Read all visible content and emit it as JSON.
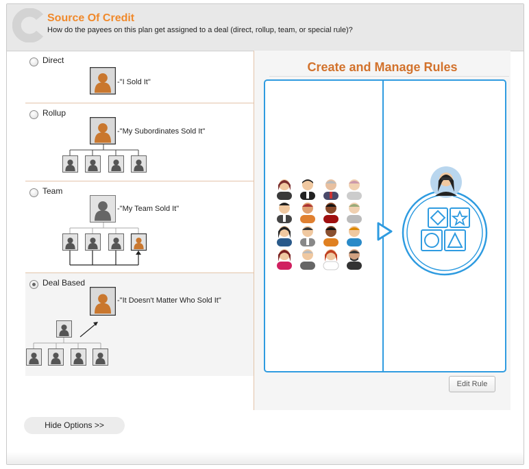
{
  "header": {
    "title": "Source Of Credit",
    "subtitle": "How do the payees on this plan get assigned to a deal (direct, rollup, team, or special rule)?"
  },
  "options": [
    {
      "label": "Direct",
      "quote": "-\"I Sold It\"",
      "selected": false
    },
    {
      "label": "Rollup",
      "quote": "-\"My Subordinates Sold It\"",
      "selected": false
    },
    {
      "label": "Team",
      "quote": "-\"My Team Sold It\"",
      "selected": false
    },
    {
      "label": "Deal Based",
      "quote": "-\"It Doesn't Matter Who Sold It\"",
      "selected": true
    }
  ],
  "rules_panel": {
    "title": "Create and Manage Rules",
    "edit_button": "Edit Rule"
  },
  "footer": {
    "hide_options": "Hide Options >>"
  },
  "colors": {
    "accent_orange": "#f0892b",
    "rules_title": "#d2722c",
    "panel_blue": "#2e9be0"
  }
}
